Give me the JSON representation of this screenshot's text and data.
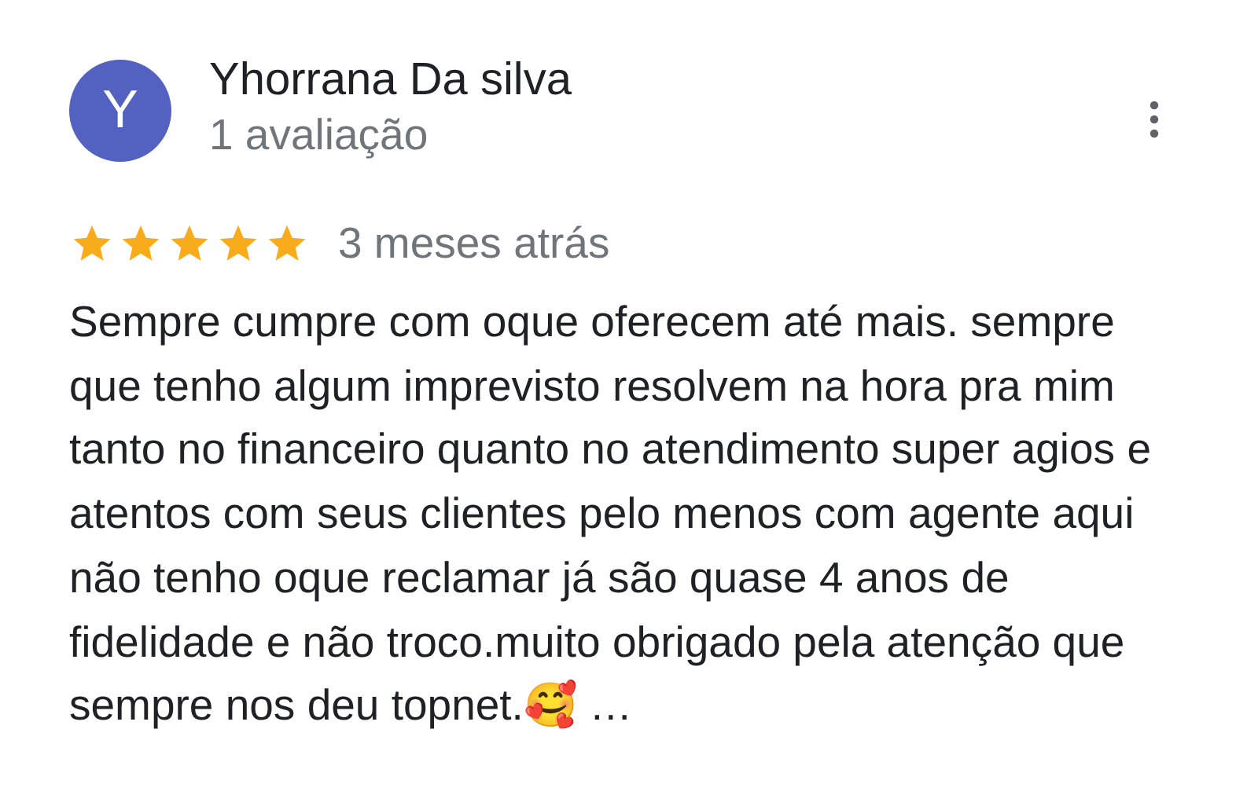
{
  "review": {
    "avatar": {
      "initial": "Y"
    },
    "author": "Yhorrana Da silva",
    "subtitle": "1 avaliação",
    "stars": 5,
    "time": "3 meses atrás",
    "text": "Sempre cumpre com oque oferecem até mais. sempre que tenho algum imprevisto resolvem na hora pra mim tanto no financeiro quanto no atendimento super agios e atentos com seus clientes pelo menos com agente aqui não tenho oque reclamar já são quase 4 anos de fidelidade e não troco.muito obrigado pela atenção que sempre nos deu topnet.🥰 …"
  }
}
